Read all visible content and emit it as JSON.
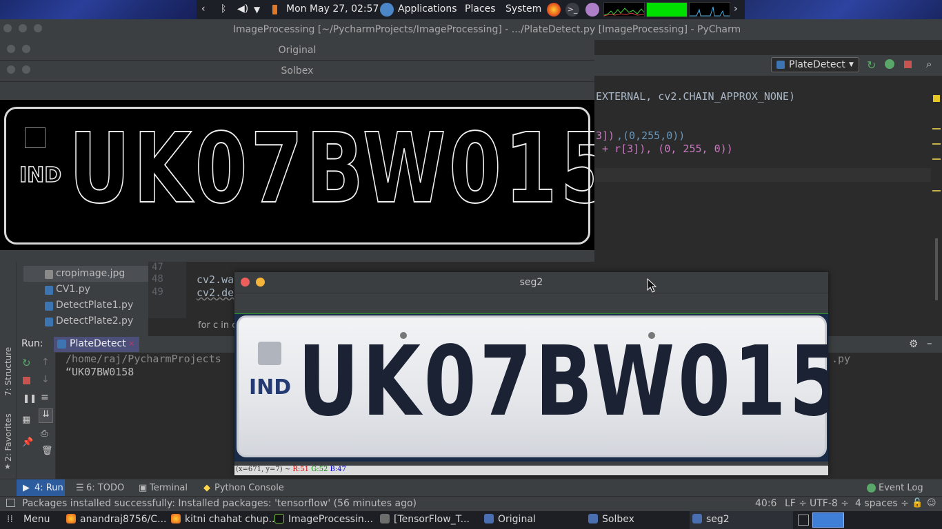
{
  "top_panel": {
    "datetime": "Mon May 27, 02:57",
    "menu_applications": "Applications",
    "menu_places": "Places",
    "menu_system": "System"
  },
  "pycharm": {
    "title": "ImageProcessing [~/PycharmProjects/ImageProcessing] - .../PlateDetect.py [ImageProcessing] - PyCharm",
    "run_config": "PlateDetect"
  },
  "windows": {
    "original_title": "Original",
    "solbex_title": "Solbex",
    "seg2_title": "seg2",
    "seg2_status": {
      "coords": "(x=671, y=7) ~",
      "r": "R:51",
      "g": "G:52",
      "b": "B:47"
    }
  },
  "plates": {
    "region": "IND",
    "number": "UK07BW0158"
  },
  "editor": {
    "line1": "EXTERNAL, cv2.CHAIN_APPROX_NONE)",
    "line2a": "3])",
    "line2b": ",(0,255,0))",
    "line3": " + r[3]), (0, 255, 0))",
    "gutter": [
      "47",
      "48",
      "49"
    ],
    "code48": "cv2.wa",
    "code49": "cv2.de",
    "breadcrumb": "for c in c"
  },
  "project_tree": [
    "cropimage.jpg",
    "CV1.py",
    "DetectPlate1.py",
    "DetectPlate2.py"
  ],
  "run_panel": {
    "label": "Run:",
    "tab": "PlateDetect",
    "output_path": "/home/raj/PycharmProjects",
    "output_path_tail": ".py",
    "output_result": "“UK07BW0158"
  },
  "side_labels": {
    "structure": "7: Structure",
    "favorites": "2: Favorites"
  },
  "tool_tabs": {
    "run": "4: Run",
    "todo": "6: TODO",
    "terminal": "Terminal",
    "python_console": "Python Console",
    "event_log": "Event Log"
  },
  "status_bar": {
    "message": "Packages installed successfully: Installed packages: 'tensorflow' (56 minutes ago)",
    "position": "40:6",
    "line_sep": "LF ÷",
    "encoding": "UTF-8 ÷",
    "indent": "4 spaces ÷"
  },
  "taskbar": {
    "menu": "Menu",
    "items": [
      "anandraj8756/C...",
      "kitni chahat chup...",
      "ImageProcessin...",
      "[TensorFlow_T...",
      "Original",
      "Solbex",
      "seg2"
    ]
  },
  "colors": {
    "ide_bg": "#2b2b2b",
    "panel_bg": "#3c3f41",
    "accent_tab": "#4b4f7a",
    "code_string_pink": "#cc7ac2",
    "code_number_blue": "#6897bb"
  }
}
